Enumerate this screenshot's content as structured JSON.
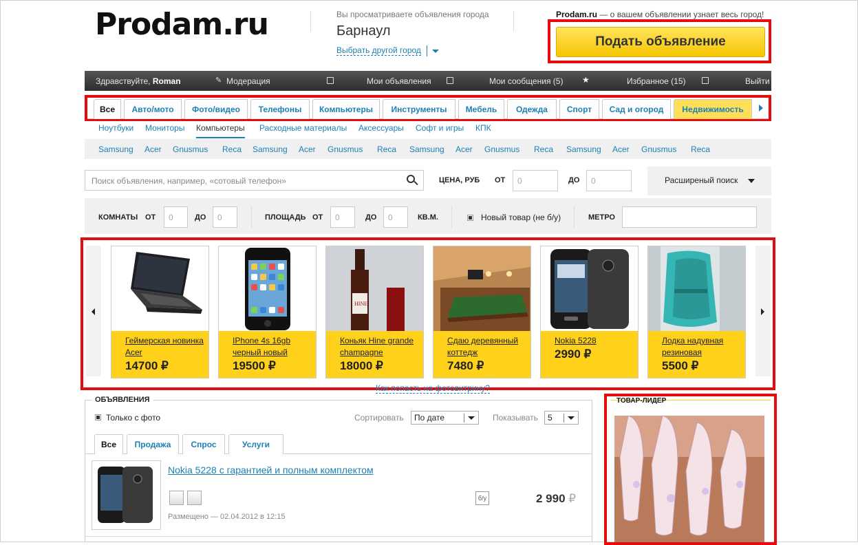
{
  "header": {
    "logo": "Prodam.ru",
    "city_note": "Вы просматриваете объявления города",
    "city": "Барнаул",
    "city_change": "Выбрать другой город",
    "slogan_brand": "Prodam.ru",
    "slogan_rest": " — о вашем объявлении узнает весь город!",
    "post_button": "Подать объявление"
  },
  "userbar": {
    "greeting": "Здравствуйте, ",
    "username": "Roman",
    "moderation": "Модерация",
    "my_ads": "Мои объявления",
    "my_messages": "Мои сообщения (5)",
    "favorites": "Избранное (15)",
    "logout": "Выйти"
  },
  "categories": [
    "Все",
    "Авто/мото",
    "Фото/видео",
    "Телефоны",
    "Компьютеры",
    "Инструменты",
    "Мебель",
    "Одежда",
    "Спорт",
    "Сад и огород",
    "Недвижимость"
  ],
  "subcategories": [
    "Ноутбуки",
    "Мониторы",
    "Компьютеры",
    "Расходные материалы",
    "Аксессуары",
    "Софт и игры",
    "КПК"
  ],
  "brands": [
    "Samsung",
    "Acer",
    "Gnusmus",
    "Reca",
    "Samsung",
    "Acer",
    "Gnusmus",
    "Reca",
    "Samsung",
    "Acer",
    "Gnusmus",
    "Reca",
    "Samsung",
    "Acer",
    "Gnusmus",
    "Reca"
  ],
  "search": {
    "placeholder": "Поиск объявления, например, «сотовый телефон»",
    "price_label": "ЦЕНА, РУБ",
    "from": "ОТ",
    "to": "ДО",
    "from_value": "0",
    "to_value": "0",
    "advanced": "Расширеный поиск"
  },
  "filters": {
    "rooms": "КОМНАТЫ",
    "from": "ОТ",
    "to": "ДО",
    "area": "ПЛОЩАДЬ",
    "unit": "КВ.М.",
    "new_item": "Новый товар (не б/у)",
    "metro": "МЕТРО",
    "zero": "0"
  },
  "carousel": [
    {
      "title": "Геймерская новинка Acer",
      "price": "14700 ₽"
    },
    {
      "title": "IPhone 4s 16gb черный новый",
      "price": "19500 ₽"
    },
    {
      "title": "Коньяк Hine grande champagne",
      "price": "18000 ₽"
    },
    {
      "title": "Сдаю деревянный коттедж",
      "price": "7480 ₽"
    },
    {
      "title": "Nokia 5228",
      "price": "2990 ₽"
    },
    {
      "title": "Лодка надувная резиновая",
      "price": "5500 ₽"
    }
  ],
  "carousel_link": "Как попасть на фотовитрину?",
  "listings": {
    "legend": "ОБЪЯВЛЕНИЯ",
    "only_photo": "Только с фото",
    "sort_label": "Сортировать",
    "sort_value": "По дате",
    "show_label": "Показывать",
    "show_value": "5",
    "tabs": [
      "Все",
      "Продажа",
      "Спрос",
      "Услуги"
    ],
    "item": {
      "title": "Nokia 5228 с гарантией и полным комплектом",
      "used": "б/у",
      "price": "2 990",
      "currency": "₽",
      "posted": "Размещено — 02.04.2012 в 12:15"
    }
  },
  "leader": {
    "title": "ТОВАР-ЛИДЕР"
  }
}
